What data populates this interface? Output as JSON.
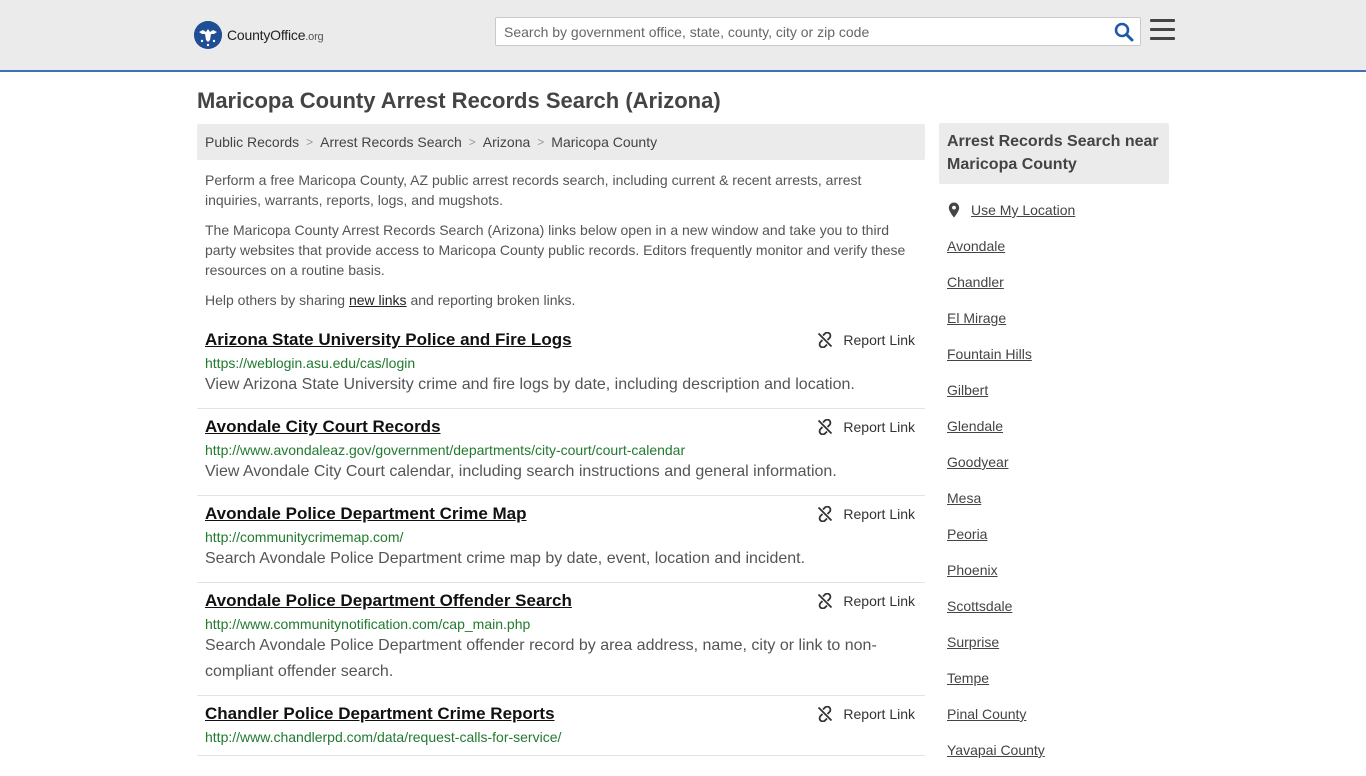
{
  "header": {
    "logo_text_main": "County",
    "logo_text_office": "Office",
    "logo_text_org": ".org",
    "search_placeholder": "Search by government office, state, county, city or zip code"
  },
  "page": {
    "title": "Maricopa County Arrest Records Search (Arizona)"
  },
  "breadcrumb": [
    "Public Records",
    "Arrest Records Search",
    "Arizona",
    "Maricopa County"
  ],
  "intro": {
    "p1": "Perform a free Maricopa County, AZ public arrest records search, including current & recent arrests, arrest inquiries, warrants, reports, logs, and mugshots.",
    "p2": "The Maricopa County Arrest Records Search (Arizona) links below open in a new window and take you to third party websites that provide access to Maricopa County public records. Editors frequently monitor and verify these resources on a routine basis.",
    "p3_before": "Help others by sharing ",
    "p3_link": "new links",
    "p3_after": " and reporting broken links."
  },
  "report_label": "Report Link",
  "results": [
    {
      "title": "Arizona State University Police and Fire Logs",
      "url": "https://weblogin.asu.edu/cas/login",
      "desc": "View Arizona State University crime and fire logs by date, including description and location."
    },
    {
      "title": "Avondale City Court Records",
      "url": "http://www.avondaleaz.gov/government/departments/city-court/court-calendar",
      "desc": "View Avondale City Court calendar, including search instructions and general information."
    },
    {
      "title": "Avondale Police Department Crime Map",
      "url": "http://communitycrimemap.com/",
      "desc": "Search Avondale Police Department crime map by date, event, location and incident."
    },
    {
      "title": "Avondale Police Department Offender Search",
      "url": "http://www.communitynotification.com/cap_main.php",
      "desc": "Search Avondale Police Department offender record by area address, name, city or link to non-compliant offender search."
    },
    {
      "title": "Chandler Police Department Crime Reports",
      "url": "http://www.chandlerpd.com/data/request-calls-for-service/",
      "desc": ""
    }
  ],
  "sidebar": {
    "heading": "Arrest Records Search near Maricopa County",
    "use_location": "Use My Location",
    "links": [
      "Avondale",
      "Chandler",
      "El Mirage",
      "Fountain Hills",
      "Gilbert",
      "Glendale",
      "Goodyear",
      "Mesa",
      "Peoria",
      "Phoenix",
      "Scottsdale",
      "Surprise",
      "Tempe",
      "Pinal County",
      "Yavapai County"
    ]
  },
  "colors": {
    "accent": "#3d71b8",
    "url_green": "#217a2e",
    "logo_blue": "#1f4e95"
  }
}
